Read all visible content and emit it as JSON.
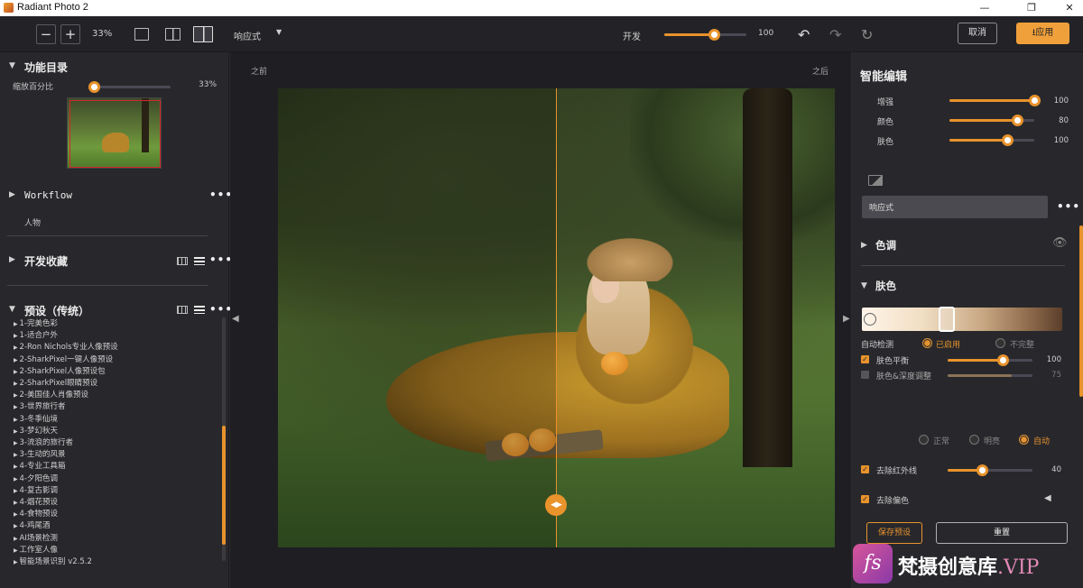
{
  "window": {
    "title": "Radiant Photo 2",
    "controls": [
      "—",
      "❐",
      "✕"
    ]
  },
  "toolbar": {
    "zoom_minus": "−",
    "zoom_plus": "+",
    "zoom_value": "33%",
    "preset_label": "响应式",
    "preset_caret": "▼",
    "develop_label": "开发",
    "develop_value": "100",
    "develop_level": 0.6,
    "cancel": "取消",
    "apply": "应用",
    "apply_icon": "download-icon"
  },
  "left": {
    "catalog_title": "功能目录",
    "zoom_label": "缩放百分比",
    "zoom_value": "33%",
    "zoom_level": 0.05,
    "workflow_title": "Workflow",
    "workflow_item": "人物",
    "favorites_title": "开发收藏",
    "presets_title": "预设（传统）",
    "presets": [
      "1-完美色彩",
      "1-适合户外",
      "2-Ron Nichols专业人像预设",
      "2-SharkPixel一键人像预设",
      "2-SharkPixel人像预设包",
      "2-SharkPixel眼睛预设",
      "2-美国佳人肖像预设",
      "3-世界旅行者",
      "3-冬季仙境",
      "3-梦幻秋天",
      "3-流浪的旅行者",
      "3-生动的风景",
      "4-专业工具箱",
      "4-夕阳色调",
      "4-复古影调",
      "4-烟花预设",
      "4-食物预设",
      "4-鸡尾酒",
      "AI场景检测",
      "工作室人像",
      "智能场景识别 v2.5.2"
    ],
    "more": "•••"
  },
  "canvas": {
    "before": "之前",
    "after": "之后",
    "handle": "◀▶",
    "left_arrow": "◀",
    "right_arrow": "▶"
  },
  "right": {
    "smart_title": "智能编辑",
    "smart_sliders": [
      {
        "label": "增强",
        "value": "100",
        "level": 1.0
      },
      {
        "label": "颜色",
        "value": "80",
        "level": 0.8
      },
      {
        "label": "肤色",
        "value": "100",
        "level": 0.68
      }
    ],
    "preset_name": "响应式",
    "tone_title": "色调",
    "skin_title": "肤色",
    "auto_detect": "自动检测",
    "enabled": "已启用",
    "incomplete": "不完整",
    "skin_balance": "肤色平衡",
    "skin_balance_value": "100",
    "skin_balance_level": 0.65,
    "skin_depth": "肤色&深度调整",
    "skin_depth_value": "75",
    "skin_depth_level": 0.75,
    "mode_normal": "正常",
    "mode_bright": "明亮",
    "mode_auto": "自动",
    "remove_ir": "去除红外线",
    "remove_ir_value": "40",
    "remove_ir_level": 0.4,
    "remove_cast": "去除偏色",
    "cast_arrow": "◀",
    "save_preset": "保存预设",
    "reset": "重置"
  },
  "watermark": {
    "logo": "fs",
    "text": "梵摄创意库",
    "vip": ".VIP"
  },
  "colors": {
    "accent": "#e8932c",
    "panel": "#28282c",
    "toolbar": "#232327"
  }
}
